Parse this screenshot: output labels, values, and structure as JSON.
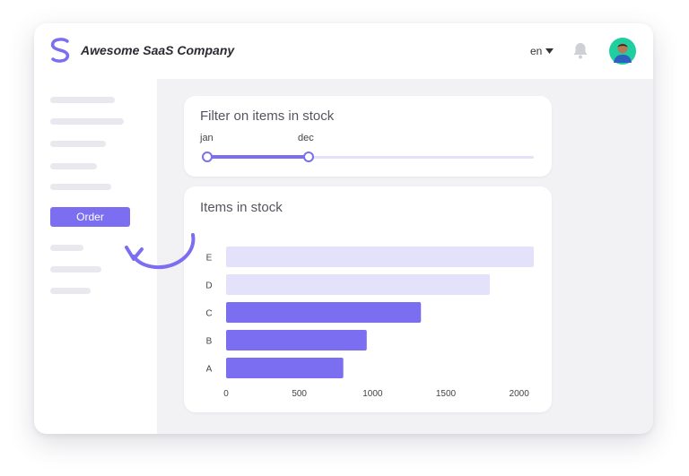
{
  "app": {
    "brand": "Awesome SaaS Company",
    "language": "en",
    "accent": "#7b6ef0",
    "accent_light": "#e4e1fb"
  },
  "sidebar": {
    "order_button": "Order"
  },
  "filter": {
    "title": "Filter on items in stock",
    "start_label": "jan",
    "end_label": "dec"
  },
  "chart_data": {
    "type": "bar",
    "orientation": "horizontal",
    "title": "Items in stock",
    "categories": [
      "A",
      "B",
      "C",
      "D",
      "E"
    ],
    "values": [
      800,
      960,
      1330,
      1800,
      2100
    ],
    "highlighted": [
      true,
      true,
      true,
      false,
      false
    ],
    "colors": {
      "highlighted": "#7b6ef0",
      "muted": "#e4e1fb"
    },
    "xticks": [
      0,
      500,
      1000,
      1500,
      2000
    ],
    "xlim": [
      0,
      2100
    ],
    "grid": false
  }
}
